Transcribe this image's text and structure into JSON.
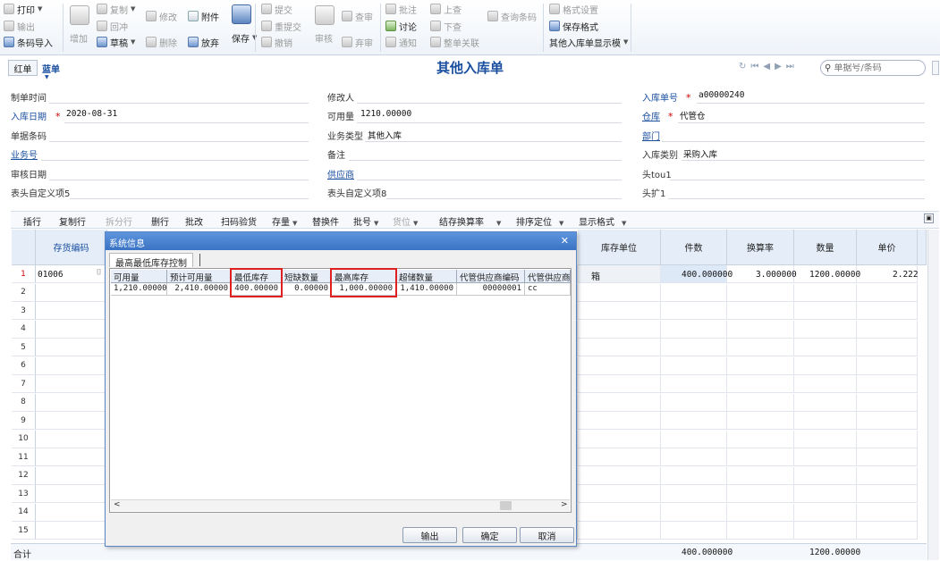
{
  "toolbar": {
    "print": "打印",
    "export": "输出",
    "barcode_import": "条码导入",
    "add": "增加",
    "copy": "复制",
    "write_back": "回冲",
    "draft": "草稿",
    "modify": "修改",
    "delete": "删除",
    "attach": "附件",
    "abandon": "放弃",
    "save": "保存",
    "submit": "提交",
    "resubmit": "重提交",
    "revoke": "撤销",
    "audit": "审核",
    "check": "查审",
    "reject": "弃审",
    "annotate": "批注",
    "discuss": "讨论",
    "notify": "通知",
    "prev": "上查",
    "next": "下查",
    "link": "整单关联",
    "query_barcode": "查询条码",
    "format_settings": "格式设置",
    "save_format": "保存格式",
    "display_template": "其他入库单显示模"
  },
  "header": {
    "red": "红单",
    "blue": "蓝单",
    "title": "其他入库单",
    "search_placeholder": "单据号/条码"
  },
  "form": {
    "create_time": {
      "label": "制单时间",
      "value": ""
    },
    "modifier": {
      "label": "修改人",
      "value": ""
    },
    "doc_no": {
      "label": "入库单号",
      "value": "a00000240"
    },
    "in_date": {
      "label": "入库日期",
      "value": "2020-08-31"
    },
    "available": {
      "label": "可用量",
      "value": "1210.00000"
    },
    "warehouse": {
      "label": "仓库",
      "value": "代管仓"
    },
    "barcode": {
      "label": "单据条码",
      "value": ""
    },
    "biz_type": {
      "label": "业务类型",
      "value": "其他入库"
    },
    "dept": {
      "label": "部门",
      "value": ""
    },
    "biz_no": {
      "label": "业务号",
      "value": ""
    },
    "remark": {
      "label": "备注",
      "value": ""
    },
    "in_category": {
      "label": "入库类别",
      "value": "采购入库"
    },
    "audit_date": {
      "label": "审核日期",
      "value": ""
    },
    "supplier": {
      "label": "供应商",
      "value": ""
    },
    "head_tou1": {
      "label": "头tou1",
      "value": ""
    },
    "custom5": {
      "label": "表头自定义项5",
      "value": ""
    },
    "custom8": {
      "label": "表头自定义项8",
      "value": ""
    },
    "ext1": {
      "label": "头扩1",
      "value": ""
    }
  },
  "grid_toolbar": [
    "插行",
    "复制行",
    "拆分行",
    "删行",
    "批改",
    "扫码验货",
    "存量",
    "替换件",
    "批号",
    "货位",
    "结存换算率",
    "排序定位",
    "显示格式"
  ],
  "grid": {
    "headers": {
      "code": "存货编码",
      "unit": "库存单位",
      "pieces": "件数",
      "rate": "换算率",
      "qty": "数量",
      "price": "单价"
    },
    "rows": [
      "1",
      "2",
      "3",
      "4",
      "5",
      "6",
      "7",
      "8",
      "9",
      "10",
      "11",
      "12",
      "13",
      "14",
      "15"
    ],
    "row1": {
      "code": "01006",
      "unit": "箱",
      "pieces": "400.000000",
      "rate": "3.000000",
      "qty": "1200.00000",
      "price": "2.222"
    },
    "total_label": "合计",
    "total_pieces": "400.000000",
    "total_qty": "1200.00000"
  },
  "dialog": {
    "title": "系统信息",
    "tab": "最高最低库存控制",
    "columns": [
      "可用量",
      "预计可用量",
      "最低库存",
      "短缺数量",
      "最高库存",
      "超储数量",
      "代管供应商编码",
      "代管供应商"
    ],
    "row": [
      "1,210.00000",
      "2,410.00000",
      "400.00000",
      "0.00000",
      "1,000.00000",
      "1,410.00000",
      "00000001",
      "cc"
    ],
    "buttons": {
      "export": "输出",
      "ok": "确定",
      "cancel": "取消"
    }
  },
  "colors": {
    "accent": "#3a73c4",
    "highlight": "#e02020",
    "header_bg": "#e4edf8"
  }
}
